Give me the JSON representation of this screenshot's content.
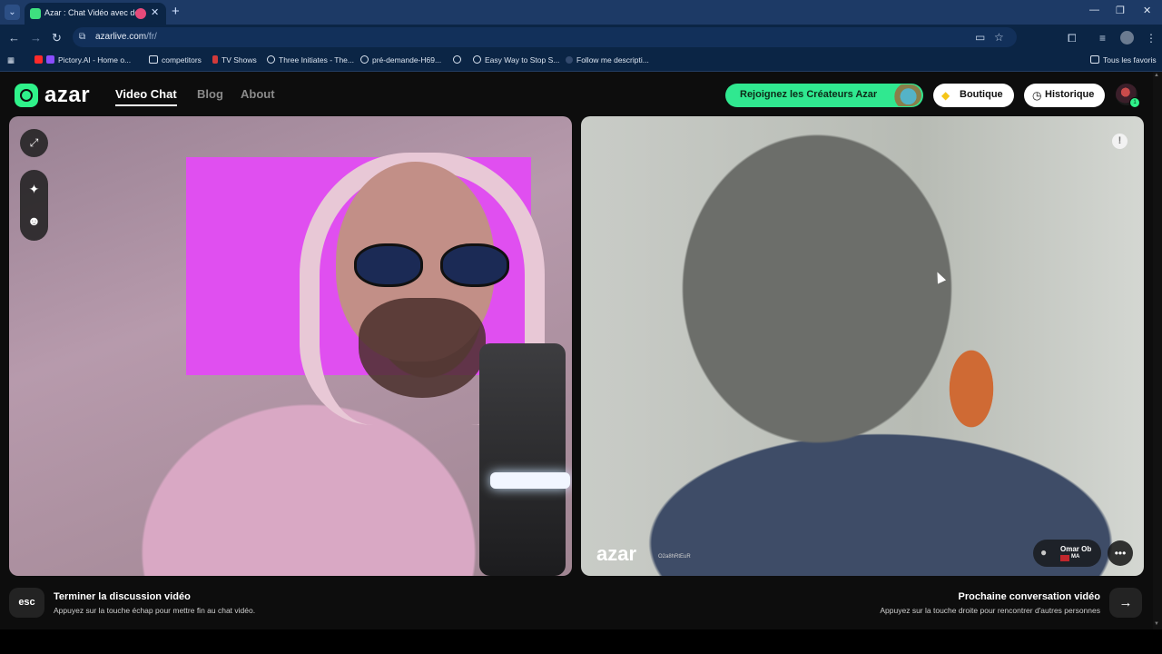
{
  "browser": {
    "tab_title": "Azar : Chat Vidéo avec de n",
    "address": "azarlive.com",
    "address_path": "/fr/",
    "bookmarks": [
      {
        "label": "Pictory.AI - Home o...",
        "icon": "youtube-icon"
      },
      {
        "label": "competitors",
        "icon": "folder-icon"
      },
      {
        "label": "TV Shows",
        "icon": "bookmark-icon"
      },
      {
        "label": "Three Initiates - The...",
        "icon": "globe-icon"
      },
      {
        "label": "pré-demande-H69...",
        "icon": "globe-icon"
      },
      {
        "label": "Easy Way to Stop S...",
        "icon": "globe-icon"
      },
      {
        "label": "Follow me descripti...",
        "icon": "globe-icon"
      }
    ],
    "all_bookmarks": "Tous les favoris"
  },
  "site": {
    "logo": "azar",
    "nav": [
      "Video Chat",
      "Blog",
      "About"
    ],
    "creators_cta": "Rejoignez les Créateurs Azar",
    "shop_button": "Boutique",
    "history_button": "Historique",
    "avatar_badge": "1"
  },
  "remote": {
    "watermark": "azar",
    "watermark_id": "O2a8hRtEuR",
    "peer_name": "Omar Ob",
    "peer_country": "MA"
  },
  "controls": {
    "esc_key": "esc",
    "end_title": "Terminer la discussion vidéo",
    "end_sub": "Appuyez sur la touche échap pour mettre fin au chat vidéo.",
    "next_title": "Prochaine conversation vidéo",
    "next_sub": "Appuyez sur la touche droite pour rencontrer d'autres personnes",
    "next_key": "→"
  },
  "colors": {
    "brand_green": "#30e890",
    "browser_chrome": "#0b2545"
  }
}
